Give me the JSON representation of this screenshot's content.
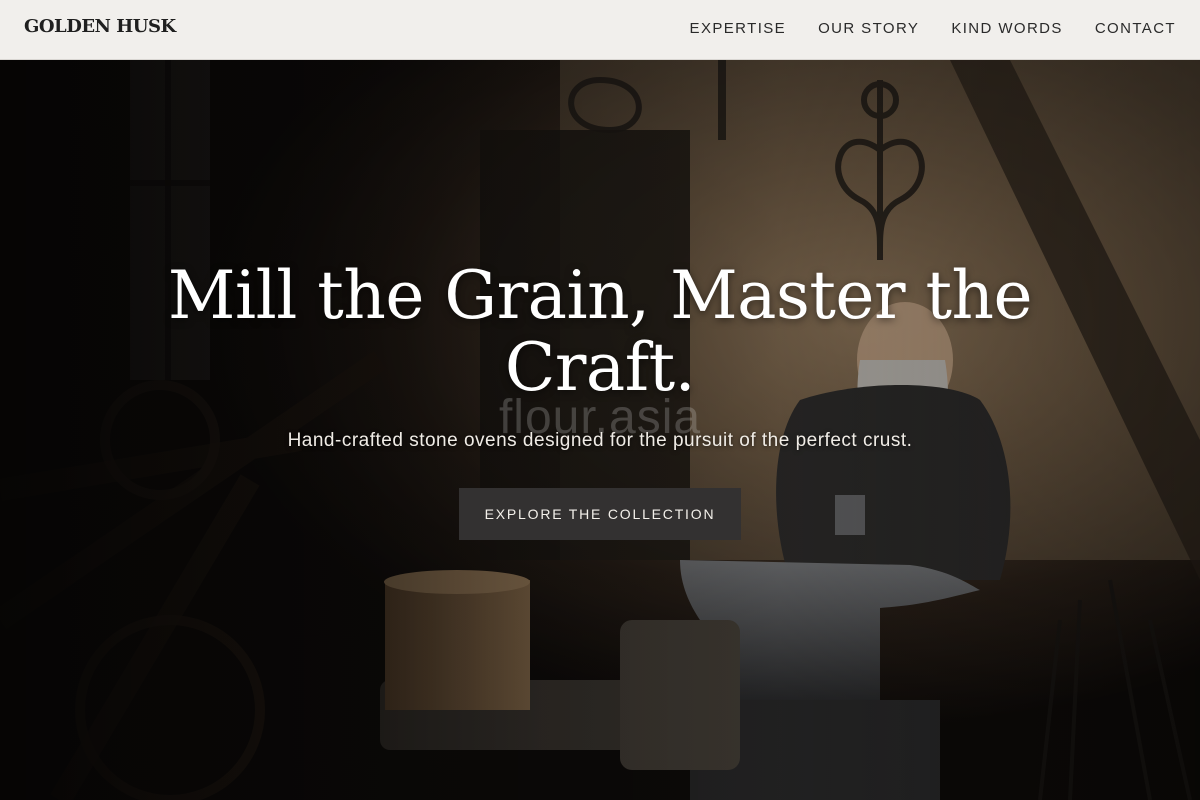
{
  "brand": {
    "name": "GOLDEN HUSK"
  },
  "nav": {
    "items": [
      {
        "label": "EXPERTISE"
      },
      {
        "label": "OUR STORY"
      },
      {
        "label": "KIND WORDS"
      },
      {
        "label": "CONTACT"
      }
    ]
  },
  "hero": {
    "title": "Mill the Grain, Master the Craft.",
    "watermark": "flour.asia",
    "subtitle": "Hand-crafted stone ovens designed for the pursuit of the perfect crust.",
    "cta_label": "EXPLORE THE COLLECTION",
    "image_description": "blacksmith-workshop-photo"
  },
  "colors": {
    "nav_background": "#f1efec",
    "cta_background": "#333131",
    "text_light": "#ffffff"
  }
}
